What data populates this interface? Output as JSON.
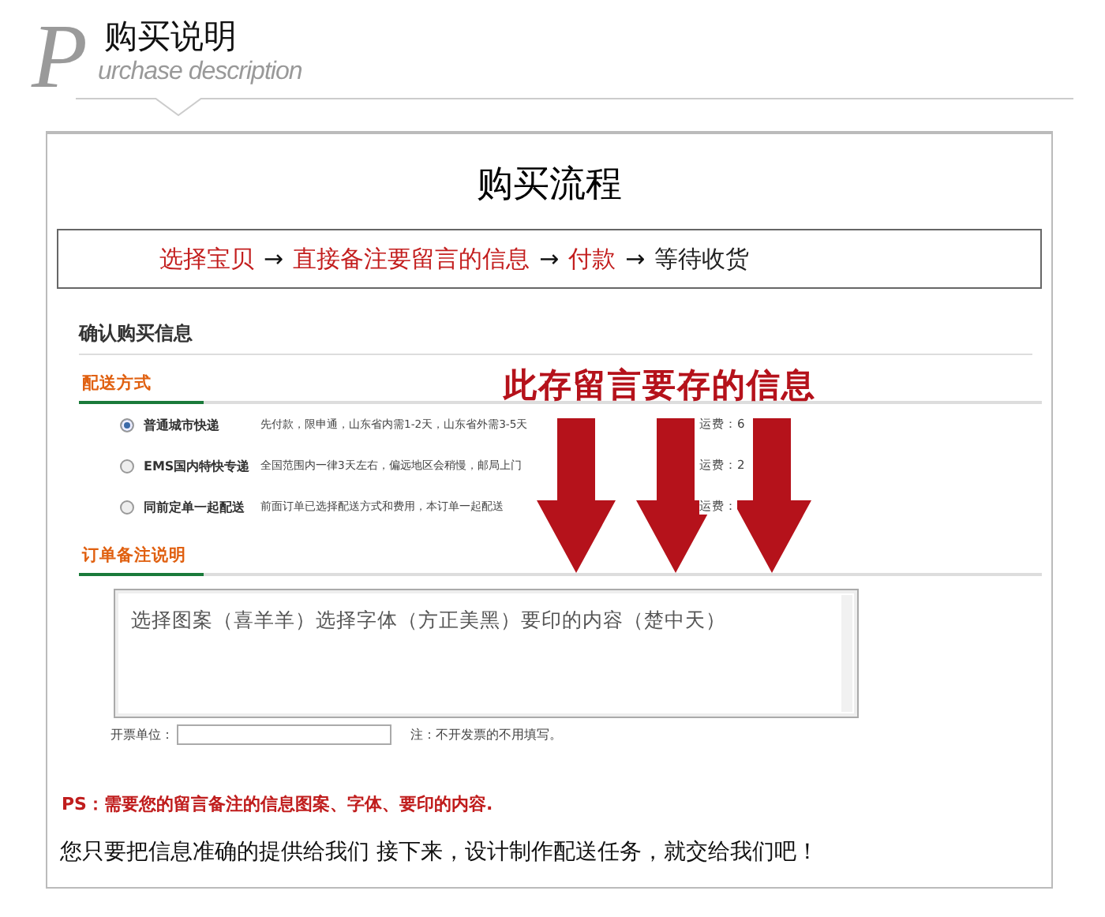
{
  "header": {
    "logo_letter": "P",
    "title": "购买说明",
    "subtitle": "urchase description"
  },
  "panel_title": "购买流程",
  "flow": [
    {
      "kind": "step",
      "text": "选择宝贝",
      "highlight": true
    },
    {
      "kind": "arrow",
      "text": "→"
    },
    {
      "kind": "step",
      "text": "直接备注要留言的信息",
      "highlight": true
    },
    {
      "kind": "arrow",
      "text": "→"
    },
    {
      "kind": "step",
      "text": "付款",
      "highlight": true
    },
    {
      "kind": "arrow",
      "text": "→"
    },
    {
      "kind": "step",
      "text": "等待收货",
      "highlight": false
    }
  ],
  "form": {
    "title": "确认购买信息",
    "shipping": {
      "heading": "配送方式",
      "options": [
        {
          "label": "普通城市快递",
          "note": "先付款，限申通，山东省内需1-2天，山东省外需3-5天",
          "fee": "运费：6",
          "selected": true
        },
        {
          "label": "EMS国内特快专递",
          "note": "全国范围内一律3天左右，偏远地区会稍慢，邮局上门",
          "fee": "运费：2",
          "selected": false
        },
        {
          "label": "同前定单一起配送",
          "note": "前面订单已选择配送方式和费用，本订单一起配送",
          "fee": "运费：",
          "selected": false
        }
      ]
    },
    "remarks": {
      "heading": "订单备注说明",
      "value": "选择图案（喜羊羊）选择字体（方正美黑）要印的内容（楚中天）"
    },
    "invoice": {
      "label": "开票单位：",
      "note": "注：不开发票的不用填写。"
    }
  },
  "callout": "此存留言要存的信息",
  "ps": "PS：需要您的留言备注的信息图案、字体、要印的内容.",
  "footer": "您只要把信息准确的提供给我们  接下来，设计制作配送任务，就交给我们吧！"
}
